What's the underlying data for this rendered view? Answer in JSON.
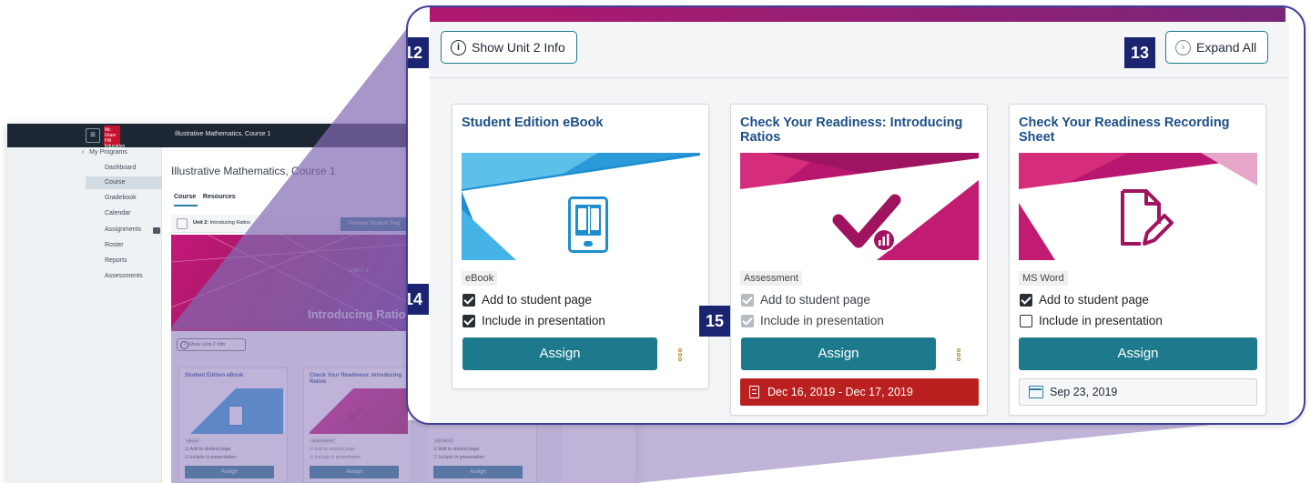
{
  "background_app": {
    "header_title": "Illustrative Mathematics, Course 1",
    "logo_text": "Mc Graw Hill Education",
    "sidebar": {
      "back_label": "My Programs",
      "items": [
        "Dashboard",
        "Course",
        "Gradebook",
        "Calendar",
        "Assignments",
        "Roster",
        "Reports",
        "Assessments"
      ],
      "active": "Course"
    },
    "page_title": "Illustrative Mathematics, Course 1",
    "tabs": [
      "Course",
      "Resources"
    ],
    "unit_bar": {
      "unit_label": "Unit 2:",
      "unit_name": "Introducing Ratios",
      "preview_button": "Preview Student Pag"
    },
    "hero": {
      "kicker": "UNIT 2",
      "title": "Introducing Ratio"
    },
    "show_info_button": "Show Unit 2 Info",
    "cards": [
      {
        "title": "Student Edition eBook",
        "tag": "eBook",
        "check1": "Add to student page",
        "check2": "Include in presentation",
        "button": "Assign"
      },
      {
        "title": "Check Your Readiness: Introducing Ratios",
        "tag": "Assessment",
        "check1": "Add to student page",
        "check2": "Include in presentation",
        "button": "Assign"
      },
      {
        "title": "",
        "tag": "MS Word",
        "check1": "Add to student page",
        "check2": "Include in presentation",
        "button": "Assign"
      }
    ]
  },
  "zoom": {
    "show_info_button": "Show Unit 2 Info",
    "expand_all_button": "Expand All",
    "callouts": {
      "c12": "12",
      "c13": "13",
      "c14": "14",
      "c15": "15"
    },
    "cards": [
      {
        "title": "Student Edition eBook",
        "icon": "tablet-book-icon",
        "tag": "eBook",
        "add_to_student_page": {
          "label": "Add to student page",
          "checked": true,
          "disabled": false
        },
        "include_in_presentation": {
          "label": "Include in presentation",
          "checked": true,
          "disabled": false
        },
        "assign_label": "Assign",
        "due": ""
      },
      {
        "title": "Check Your Readiness: Introducing Ratios",
        "icon": "checkmark-chart-icon",
        "tag": "Assessment",
        "add_to_student_page": {
          "label": "Add to student page",
          "checked": true,
          "disabled": true
        },
        "include_in_presentation": {
          "label": "Include in presentation",
          "checked": true,
          "disabled": true
        },
        "assign_label": "Assign",
        "due": "Dec 16, 2019 - Dec 17, 2019"
      },
      {
        "title": "Check Your Readiness Recording Sheet",
        "icon": "document-edit-icon",
        "tag": "MS Word",
        "add_to_student_page": {
          "label": "Add to student page",
          "checked": true,
          "disabled": false
        },
        "include_in_presentation": {
          "label": "Include in presentation",
          "checked": false,
          "disabled": false
        },
        "assign_label": "Assign",
        "due": "Sep 23, 2019"
      }
    ]
  },
  "colors": {
    "teal": "#1c7a8c",
    "navy_callout": "#1a2471",
    "title_blue": "#1d4f86",
    "due_red": "#b9201f",
    "magenta": "#c5177c",
    "wedge": "#8a74b8"
  }
}
